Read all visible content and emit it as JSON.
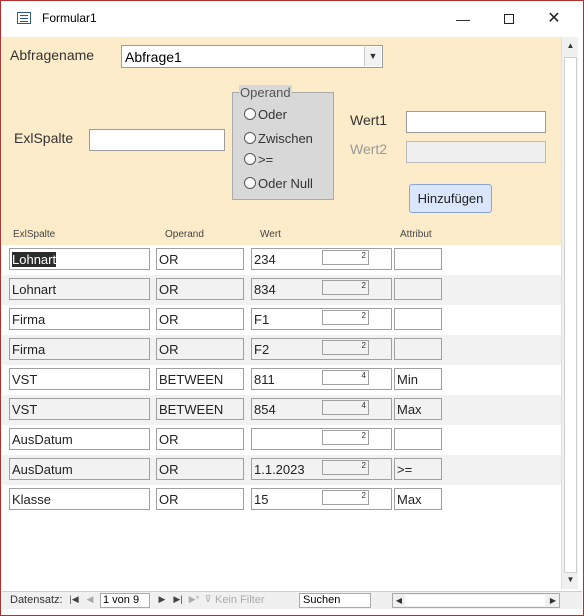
{
  "window": {
    "title": "Formular1"
  },
  "form": {
    "abfragename_label": "Abfragename",
    "abfragename_value": "Abfrage1",
    "exlspalte_label": "ExlSpalte",
    "exlspalte_value": "",
    "operand_group_title": "Operand",
    "operand_options": [
      "Oder",
      "Zwischen",
      ">=",
      "Oder Null"
    ],
    "wert1_label": "Wert1",
    "wert1_value": "",
    "wert2_label": "Wert2",
    "wert2_value": "",
    "add_button": "Hinzufügen"
  },
  "table": {
    "headers": [
      "ExlSpalte",
      "Operand",
      "Wert",
      "Attribut"
    ],
    "rows": [
      {
        "spalte": "Lohnart",
        "operand": "OR",
        "wert": "234",
        "num": "2",
        "attribut": ""
      },
      {
        "spalte": "Lohnart",
        "operand": "OR",
        "wert": "834",
        "num": "2",
        "attribut": ""
      },
      {
        "spalte": "Firma",
        "operand": "OR",
        "wert": "F1",
        "num": "2",
        "attribut": ""
      },
      {
        "spalte": "Firma",
        "operand": "OR",
        "wert": "F2",
        "num": "2",
        "attribut": ""
      },
      {
        "spalte": "VST",
        "operand": "BETWEEN",
        "wert": "811",
        "num": "4",
        "attribut": "Min"
      },
      {
        "spalte": "VST",
        "operand": "BETWEEN",
        "wert": "854",
        "num": "4",
        "attribut": "Max"
      },
      {
        "spalte": "AusDatum",
        "operand": "OR",
        "wert": "",
        "num": "2",
        "attribut": ""
      },
      {
        "spalte": "AusDatum",
        "operand": "OR",
        "wert": "1.1.2023",
        "num": "2",
        "attribut": ">="
      },
      {
        "spalte": "Klasse",
        "operand": "OR",
        "wert": "15",
        "num": "2",
        "attribut": "Max"
      }
    ]
  },
  "navigation": {
    "label": "Datensatz:",
    "current": "1 von 9",
    "filter": "Kein Filter",
    "search": "Suchen"
  },
  "icons": {
    "first": "first-record-icon",
    "prev": "prev-record-icon",
    "next": "next-record-icon",
    "last": "last-record-icon",
    "new": "new-record-icon",
    "filter": "filter-icon"
  },
  "colors": {
    "header_bg": "#fdecc9",
    "button_bg": "#d9e6fb",
    "window_border": "#b03030"
  }
}
